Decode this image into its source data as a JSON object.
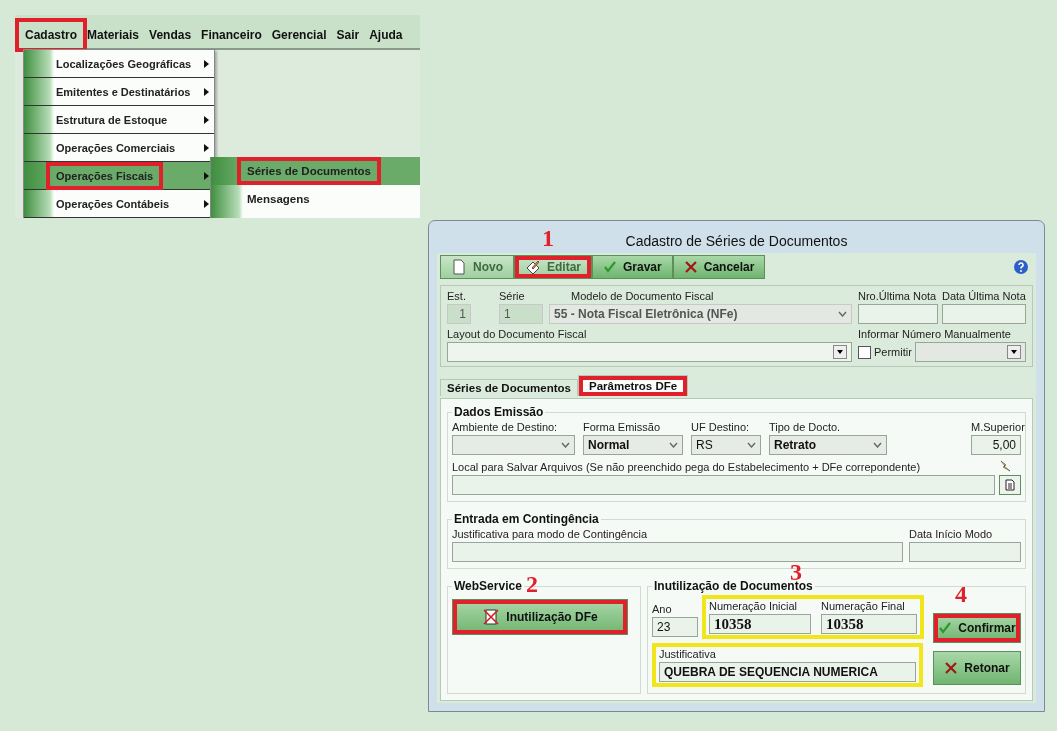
{
  "menu_bar": {
    "items": [
      {
        "label": "Cadastro",
        "highlighted": true
      },
      {
        "label": "Materiais",
        "highlighted": false
      },
      {
        "label": "Vendas",
        "highlighted": false
      },
      {
        "label": "Financeiro",
        "highlighted": false
      },
      {
        "label": "Gerencial",
        "highlighted": false
      },
      {
        "label": "Sair",
        "highlighted": false
      },
      {
        "label": "Ajuda",
        "highlighted": false
      }
    ]
  },
  "dropdown": {
    "items": [
      {
        "label": "Localizações Geográficas",
        "selected": false,
        "highlighted": false
      },
      {
        "label": "Emitentes e Destinatários",
        "selected": false,
        "highlighted": false
      },
      {
        "label": "Estrutura de Estoque",
        "selected": false,
        "highlighted": false
      },
      {
        "label": "Operações Comerciais",
        "selected": false,
        "highlighted": false
      },
      {
        "label": "Operações Fiscais",
        "selected": true,
        "highlighted": true
      },
      {
        "label": "Operações Contábeis",
        "selected": false,
        "highlighted": false
      }
    ]
  },
  "submenu": {
    "items": [
      {
        "label": "Séries de Documentos",
        "selected": true,
        "highlighted": true
      },
      {
        "label": "Mensagens",
        "selected": false,
        "highlighted": false
      }
    ]
  },
  "dialog": {
    "title": "Cadastro de Séries de Documentos",
    "toolbar": [
      {
        "label": "Novo",
        "disabled": true,
        "highlighted": false
      },
      {
        "label": "Editar",
        "disabled": true,
        "highlighted": true,
        "callout": "1"
      },
      {
        "label": "Gravar",
        "disabled": false,
        "highlighted": false
      },
      {
        "label": "Cancelar",
        "disabled": false,
        "highlighted": false
      }
    ],
    "header": {
      "est": {
        "label": "Est.",
        "value": "1"
      },
      "serie": {
        "label": "Série",
        "value": "1"
      },
      "modelo": {
        "label": "Modelo de Documento Fiscal",
        "value": "55 - Nota Fiscal Eletrônica (NFe)",
        "disabled": true
      },
      "nro_ultima_nota": {
        "label": "Nro.Última Nota"
      },
      "data_ultima_nota": {
        "label": "Data Última Nota"
      },
      "layout": {
        "label": "Layout do Documento Fiscal"
      },
      "manual": {
        "title": "Informar Número Manualmente",
        "checkbox_label": "Permitir",
        "checked": false
      }
    },
    "tabs": [
      {
        "label": "Séries de Documentos",
        "selected": false,
        "highlighted": false
      },
      {
        "label": "Parâmetros DFe",
        "selected": true,
        "highlighted": true
      }
    ],
    "dados_emissao": {
      "title": "Dados Emissão",
      "fields": [
        {
          "kind": "select",
          "label": "Ambiente de Destino:"
        },
        {
          "kind": "select",
          "label": "Forma Emissão",
          "value": "Normal"
        },
        {
          "kind": "select",
          "label": "UF Destino:",
          "value": "RS"
        },
        {
          "kind": "select",
          "label": "Tipo de Docto.",
          "value": "Retrato"
        },
        {
          "kind": "number",
          "label": "M.Superior",
          "value": "5,00"
        }
      ],
      "local_label": "Local para Salvar Arquivos (Se não preenchido pega do Estabelecimento + DFe correpondente)"
    },
    "contingencia": {
      "title": "Entrada em Contingência",
      "justificativa_label": "Justificativa para modo de Contingência",
      "data_label": "Data Início Modo"
    },
    "webservice": {
      "title": "WebService",
      "button": {
        "label": "Inutilização DFe",
        "highlighted": true,
        "callout": "2"
      }
    },
    "inutilizacao": {
      "title": "Inutilização de Documentos",
      "ano": {
        "label": "Ano",
        "value": "23"
      },
      "numeracao": {
        "highlighted": true,
        "callout": "3",
        "inicial": {
          "label": "Numeração Inicial",
          "value": "10358"
        },
        "final": {
          "label": "Numeração Final",
          "value": "10358"
        }
      },
      "justificativa": {
        "label": "Justificativa",
        "value": "QUEBRA DE SEQUENCIA NUMERICA",
        "highlighted": true
      },
      "buttons": [
        {
          "label": "Confirmar",
          "highlighted": true,
          "callout": "4"
        },
        {
          "label": "Retonar",
          "highlighted": false
        }
      ]
    }
  }
}
